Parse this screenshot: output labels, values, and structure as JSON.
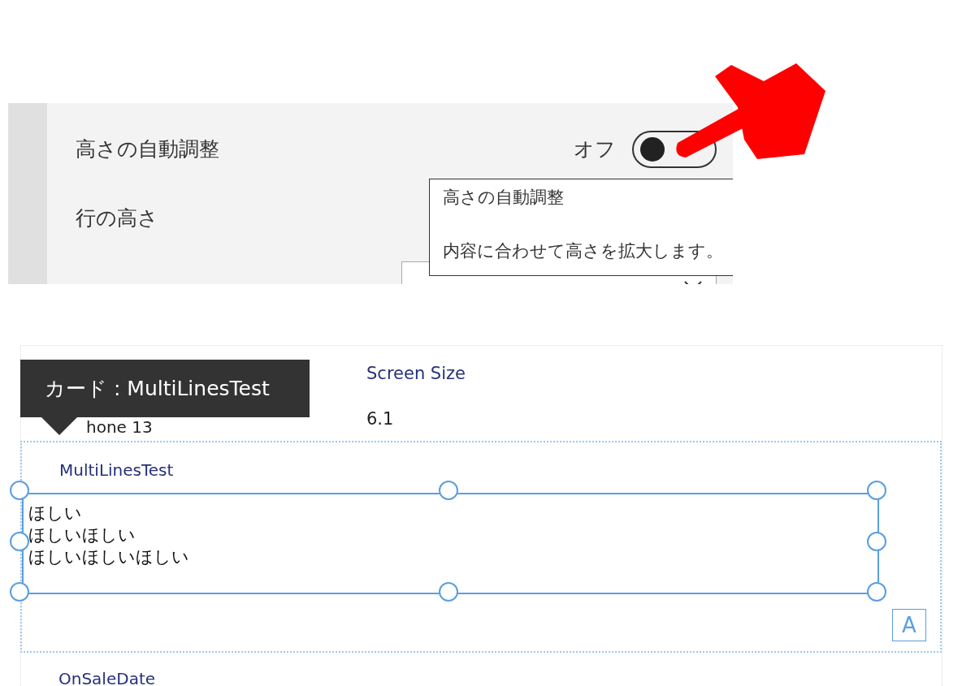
{
  "settings_panel": {
    "rows": [
      {
        "kind": "toggle",
        "label": "高さの自動調整",
        "state_text": "オフ",
        "on": false
      },
      {
        "kind": "plain",
        "label": "行の高さ"
      },
      {
        "kind": "dropdown"
      }
    ],
    "tooltip": {
      "title": "高さの自動調整",
      "description": "内容に合わせて高さを拡大します。"
    }
  },
  "canvas": {
    "tooltip": "カード : MultiLinesTest",
    "top_card": {
      "value": "hone 13",
      "screen_size_label": "Screen Size",
      "screen_size_value": "6.1"
    },
    "selected_card": {
      "label": "MultiLinesTest",
      "lines": [
        "ほしい",
        "ほしいほしい",
        "ほしいほしいほしい"
      ],
      "badge": "A",
      "selected": true
    },
    "next_card": {
      "label": "OnSaleDate"
    }
  }
}
